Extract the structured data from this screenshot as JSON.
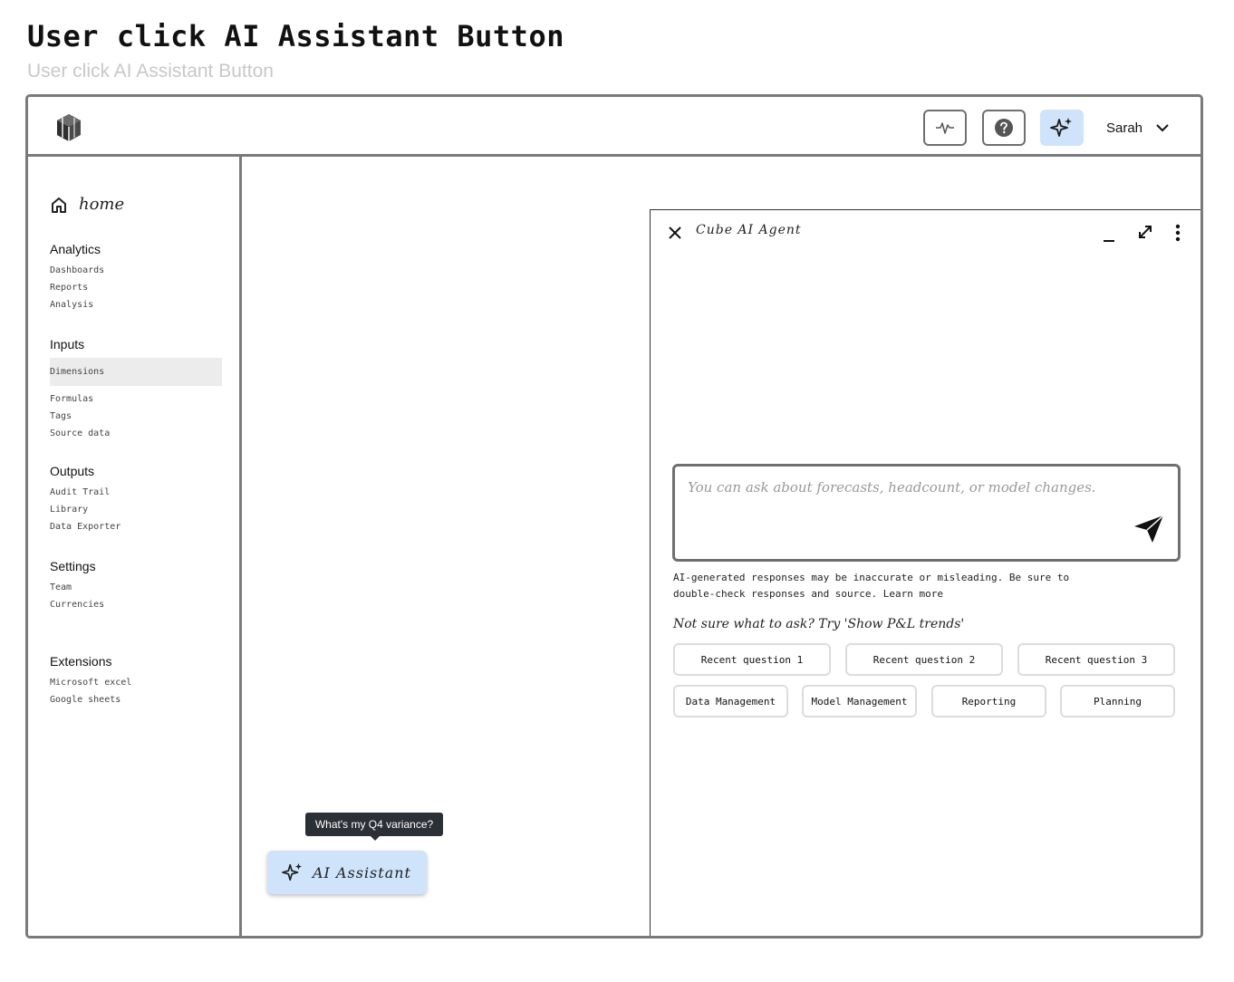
{
  "page": {
    "title": "User click AI Assistant Button",
    "subtitle": "User click AI Assistant Button"
  },
  "topbar": {
    "activity_icon": "activity-icon",
    "help_icon": "help-icon",
    "ai_icon": "sparkle-icon",
    "user_name": "Sarah",
    "ai_button_color": "#cfe3fb"
  },
  "sidebar": {
    "home_label": "home",
    "sections": [
      {
        "title": "Analytics",
        "items": [
          "Dashboards",
          "Reports",
          "Analysis"
        ]
      },
      {
        "title": "Inputs",
        "items": [
          "Dimensions",
          "Formulas",
          "Tags",
          "Source data"
        ],
        "active": "Dimensions"
      },
      {
        "title": "Outputs",
        "items": [
          "Audit Trail",
          "Library",
          "Data Exporter"
        ]
      },
      {
        "title": "Settings",
        "items": [
          "Team",
          "Currencies"
        ]
      },
      {
        "title": "Extensions",
        "items": [
          "Microsoft excel",
          "Google sheets"
        ]
      }
    ]
  },
  "ai_panel": {
    "title": "Cube AI Agent",
    "input_placeholder": "You can ask about forecasts, headcount, or model changes.",
    "input_value": "",
    "disclaimer": "AI-generated responses may be inaccurate or misleading. Be sure to double-check responses and source. Learn more",
    "suggest_hint": "Not sure what to ask? Try 'Show P&L trends'",
    "recent_questions": [
      "Recent question 1",
      "Recent question 2",
      "Recent question 3"
    ],
    "topics": [
      "Data Management",
      "Model Management",
      "Reporting",
      "Planning"
    ]
  },
  "floating": {
    "tooltip": "What's my Q4 variance?",
    "ai_button_label": "AI Assistant"
  }
}
